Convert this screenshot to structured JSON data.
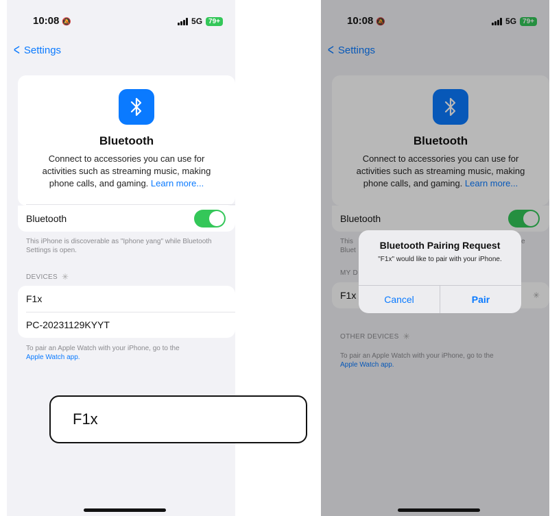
{
  "status": {
    "time": "10:08",
    "network": "5G",
    "battery": "79+"
  },
  "nav": {
    "back_label": "Settings"
  },
  "hero": {
    "title": "Bluetooth",
    "description": "Connect to accessories you can use for activities such as streaming music, making phone calls, and gaming.",
    "learn_more": "Learn more..."
  },
  "toggle": {
    "label": "Bluetooth",
    "state": "on"
  },
  "left": {
    "discoverable_note": "This iPhone is discoverable as \"Iphone yang\" while Bluetooth Settings is open.",
    "devices_header": "DEVICES",
    "devices": [
      "F1x",
      "PC-20231129KYYT"
    ],
    "watch_note": "To pair an Apple Watch with your iPhone, go to the",
    "watch_link": "Apple Watch app."
  },
  "right": {
    "note_fragment_1": "This",
    "note_fragment_2": "Bluet",
    "note_fragment_3": "e",
    "my_devices_header": "MY D",
    "device": "F1x",
    "other_devices_header": "OTHER DEVICES",
    "watch_note": "To pair an Apple Watch with your iPhone, go to the",
    "watch_link": "Apple Watch app."
  },
  "alert": {
    "title": "Bluetooth Pairing Request",
    "message": "\"F1x\" would like to pair with your iPhone.",
    "cancel": "Cancel",
    "pair": "Pair"
  },
  "callout": {
    "text": "F1x"
  },
  "colors": {
    "accent": "#0a7aff",
    "toggle_on": "#34c759"
  }
}
